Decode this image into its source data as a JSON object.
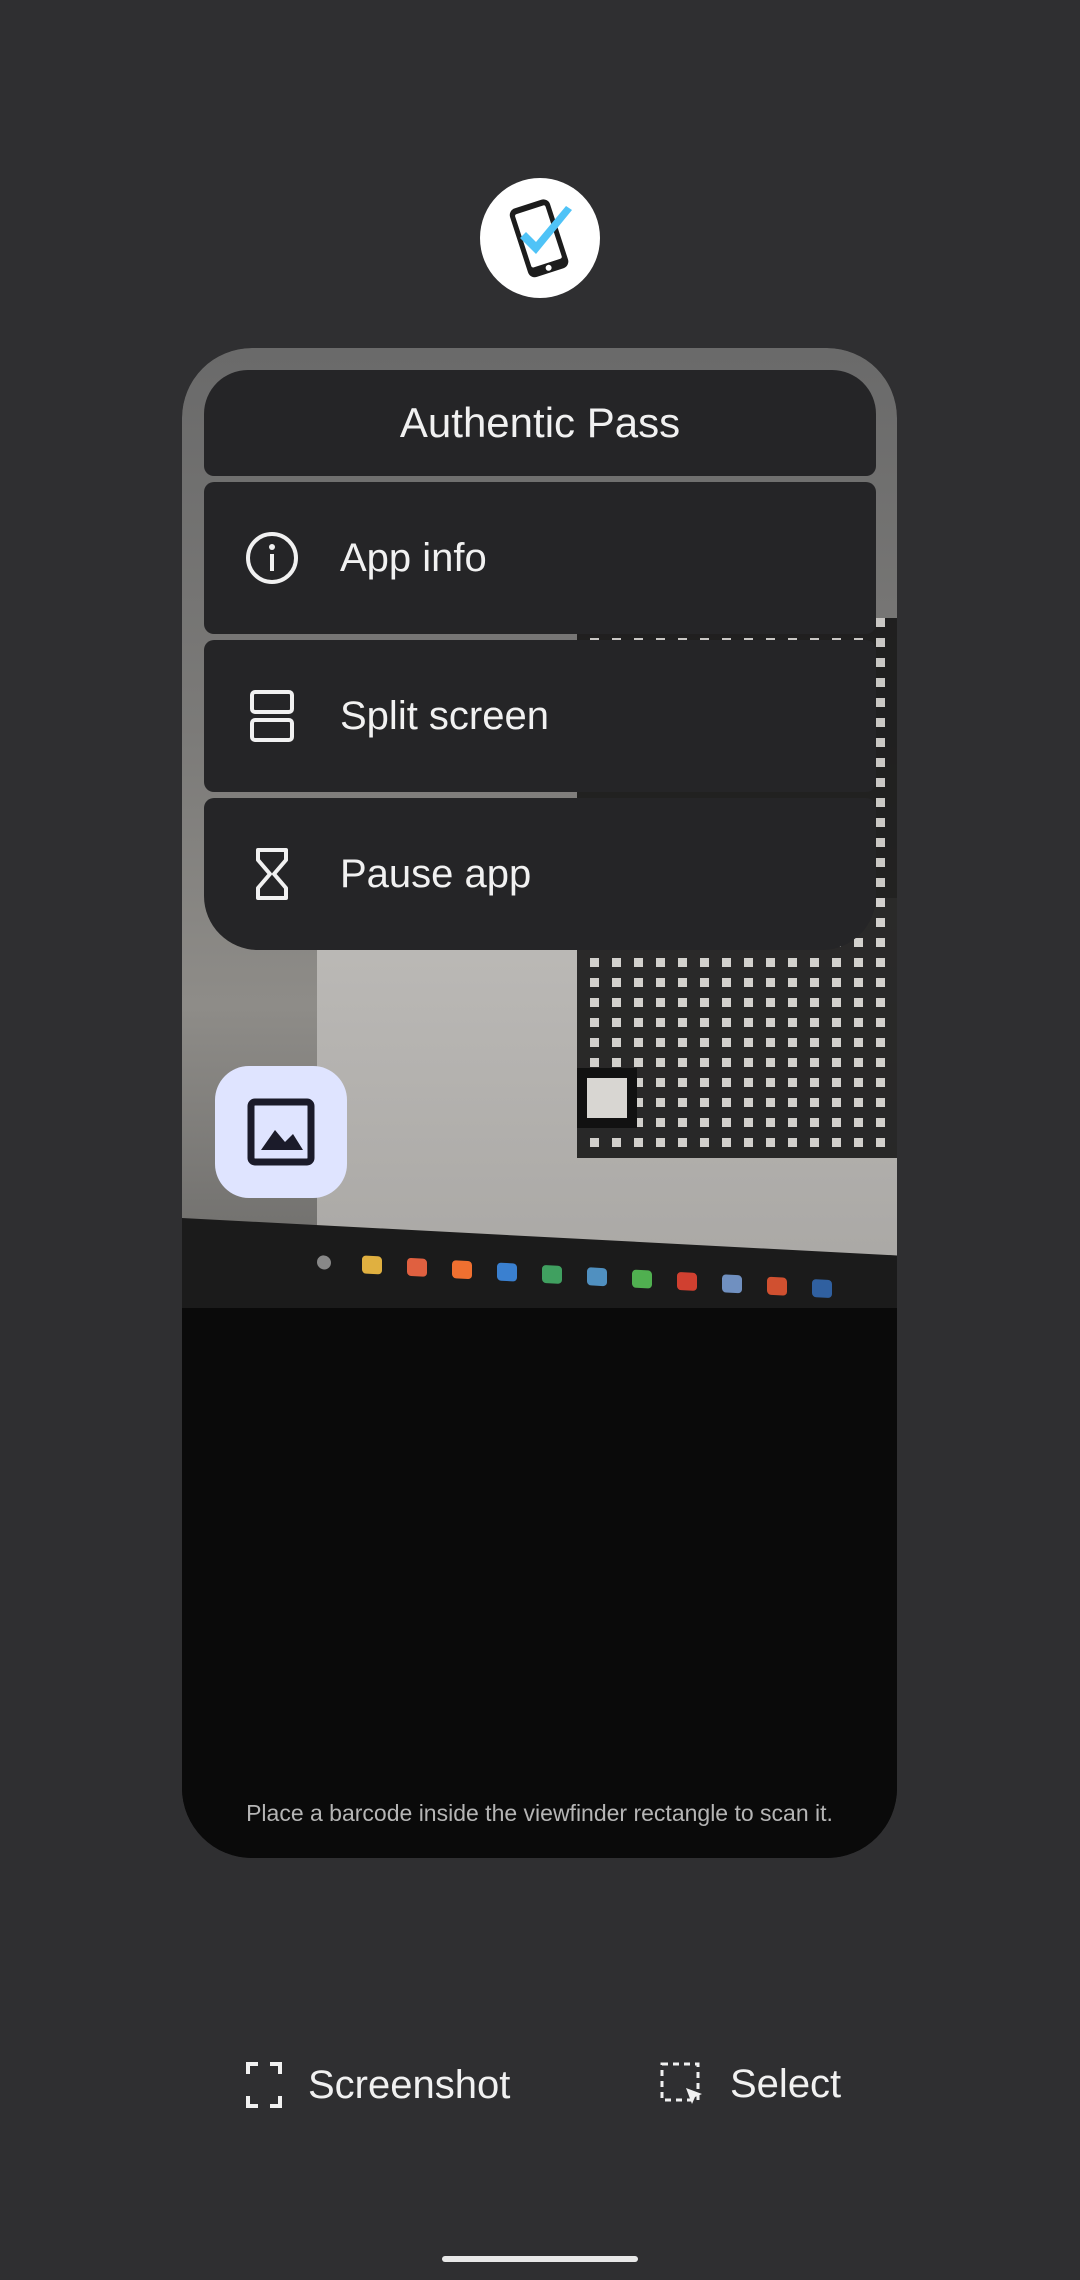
{
  "app": {
    "title": "Authentic Pass",
    "icon": "phone-check-icon",
    "brand_color": "#4fc3f7"
  },
  "menu": {
    "items": [
      {
        "label": "App info",
        "icon": "info-icon"
      },
      {
        "label": "Split screen",
        "icon": "split-screen-icon"
      },
      {
        "label": "Pause app",
        "icon": "hourglass-icon"
      }
    ]
  },
  "scanner": {
    "hint": "Place a barcode inside the viewfinder rectangle to scan it.",
    "gallery_icon": "image-icon",
    "gallery_bg": "#dfe4ff"
  },
  "actions": {
    "screenshot": "Screenshot",
    "select": "Select"
  }
}
